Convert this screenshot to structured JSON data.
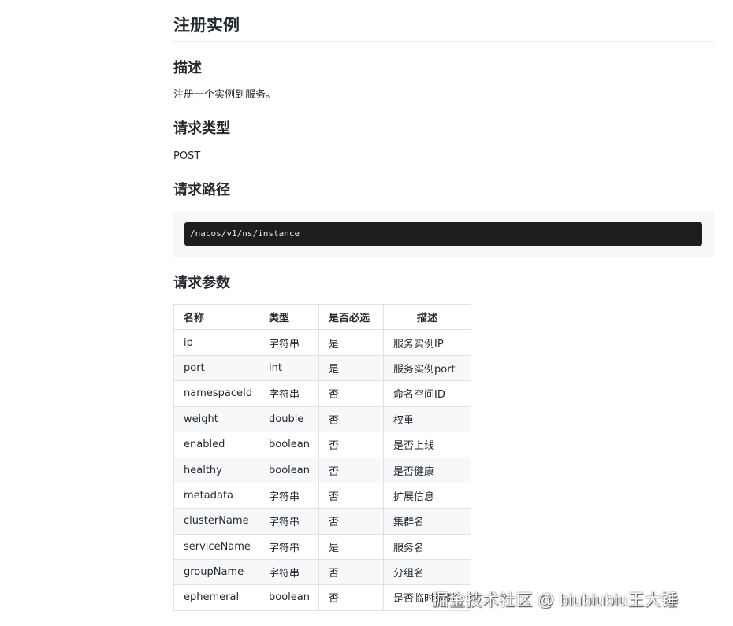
{
  "doc": {
    "title": "注册实例",
    "sections": {
      "description": {
        "heading": "描述",
        "text": "注册一个实例到服务。"
      },
      "request_type": {
        "heading": "请求类型",
        "text": "POST"
      },
      "request_path": {
        "heading": "请求路径",
        "code": "/nacos/v1/ns/instance"
      },
      "request_params": {
        "heading": "请求参数",
        "headers": [
          "名称",
          "类型",
          "是否必选",
          "描述"
        ],
        "rows": [
          [
            "ip",
            "字符串",
            "是",
            "服务实例IP"
          ],
          [
            "port",
            "int",
            "是",
            "服务实例port"
          ],
          [
            "namespaceId",
            "字符串",
            "否",
            "命名空间ID"
          ],
          [
            "weight",
            "double",
            "否",
            "权重"
          ],
          [
            "enabled",
            "boolean",
            "否",
            "是否上线"
          ],
          [
            "healthy",
            "boolean",
            "否",
            "是否健康"
          ],
          [
            "metadata",
            "字符串",
            "否",
            "扩展信息"
          ],
          [
            "clusterName",
            "字符串",
            "否",
            "集群名"
          ],
          [
            "serviceName",
            "字符串",
            "是",
            "服务名"
          ],
          [
            "groupName",
            "字符串",
            "否",
            "分组名"
          ],
          [
            "ephemeral",
            "boolean",
            "否",
            "是否临时实例"
          ]
        ]
      }
    }
  },
  "watermark": "掘金技术社区 @ biubiubiu王大锤"
}
